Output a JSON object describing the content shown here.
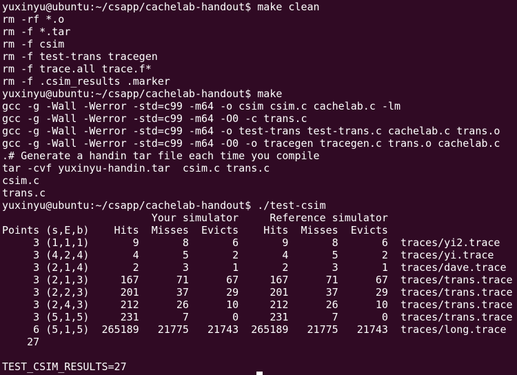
{
  "terminal": {
    "prompt": "yuxinyu@ubuntu:~/csapp/cachelab-handout$ ",
    "lines": [
      "yuxinyu@ubuntu:~/csapp/cachelab-handout$ make clean",
      "rm -rf *.o",
      "rm -f *.tar",
      "rm -f csim",
      "rm -f test-trans tracegen",
      "rm -f trace.all trace.f*",
      "rm -f .csim_results .marker",
      "yuxinyu@ubuntu:~/csapp/cachelab-handout$ make",
      "gcc -g -Wall -Werror -std=c99 -m64 -o csim csim.c cachelab.c -lm",
      "gcc -g -Wall -Werror -std=c99 -m64 -O0 -c trans.c",
      "gcc -g -Wall -Werror -std=c99 -m64 -o test-trans test-trans.c cachelab.c trans.o",
      "gcc -g -Wall -Werror -std=c99 -m64 -O0 -o tracegen tracegen.c trans.o cachelab.c",
      ".# Generate a handin tar file each time you compile",
      "tar -cvf yuxinyu-handin.tar  csim.c trans.c",
      "csim.c",
      "trans.c",
      "yuxinyu@ubuntu:~/csapp/cachelab-handout$ ./test-csim",
      "                        Your simulator     Reference simulator",
      "Points (s,E,b)    Hits  Misses  Evicts    Hits  Misses  Evicts",
      "     3 (1,1,1)       9       8       6       9       8       6  traces/yi2.trace",
      "     3 (4,2,4)       4       5       2       4       5       2  traces/yi.trace",
      "     3 (2,1,4)       2       3       1       2       3       1  traces/dave.trace",
      "     3 (2,1,3)     167      71      67     167      71      67  traces/trans.trace",
      "     3 (2,2,3)     201      37      29     201      37      29  traces/trans.trace",
      "     3 (2,4,3)     212      26      10     212      26      10  traces/trans.trace",
      "     3 (5,1,5)     231       7       0     231       7       0  traces/trans.trace",
      "     6 (5,1,5)  265189   21775   21743  265189   21775   21743  traces/long.trace",
      "    27",
      "",
      "TEST_CSIM_RESULTS=27"
    ]
  },
  "colors": {
    "background": "#300a24",
    "foreground": "#ffffff"
  }
}
